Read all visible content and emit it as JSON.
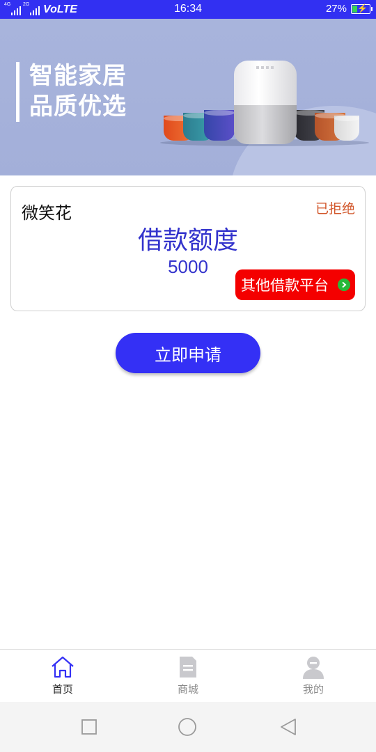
{
  "status_bar": {
    "signal1_tag": "4G",
    "signal2_tag": "2G",
    "network": "VoLTE",
    "time": "16:34",
    "battery_percent_text": "27%",
    "battery_level": 0.27,
    "signal_icon": "cell-signal-icon",
    "battery_icon": "battery-charging-icon"
  },
  "banner": {
    "line1": "智能家居",
    "line2": "品质优选"
  },
  "card": {
    "product_name": "微笑花",
    "status": "已拒绝",
    "title": "借款额度",
    "amount": "5000",
    "other_platform_label": "其他借款平台",
    "colors": {
      "accent": "#3333cc",
      "status": "#d2572b",
      "other_button": "#f40000",
      "arrow": "#27b83a"
    }
  },
  "apply_button": {
    "label": "立即申请",
    "color": "#3430f5"
  },
  "tabbar": {
    "items": [
      {
        "label": "首页",
        "icon": "home-icon",
        "active": true
      },
      {
        "label": "商城",
        "icon": "document-icon",
        "active": false
      },
      {
        "label": "我的",
        "icon": "user-icon",
        "active": false
      }
    ]
  },
  "system_nav": {
    "recent_icon": "square-icon",
    "home_icon": "circle-icon",
    "back_icon": "triangle-back-icon"
  }
}
